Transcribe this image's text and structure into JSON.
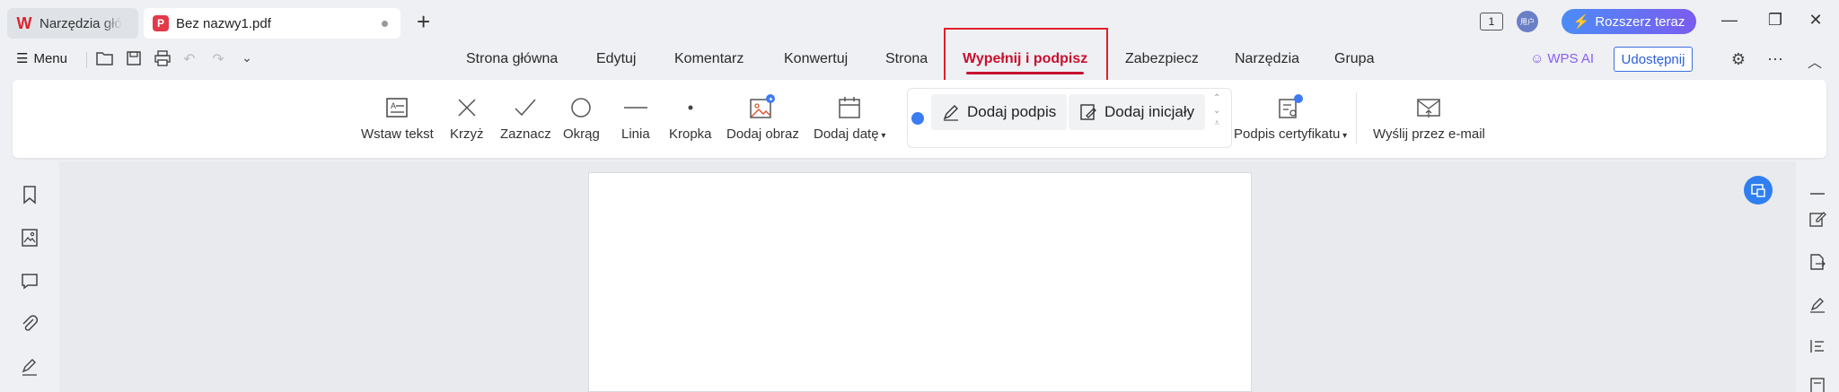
{
  "tabs": [
    {
      "label": "Narzędzia głó",
      "logo": "W",
      "active": false
    },
    {
      "label": "Bez nazwy1.pdf",
      "logo": "P",
      "active": true
    }
  ],
  "newtab_glyph": "+",
  "header": {
    "page_count_badge": "1",
    "avatar_text": "用户",
    "upgrade_label": "Rozszerz teraz",
    "window_controls": {
      "minimize": "—",
      "restore": "❐",
      "close": "✕"
    }
  },
  "menubar": {
    "menu_label": "Menu",
    "nav_tabs": [
      "Strona główna",
      "Edytuj",
      "Komentarz",
      "Konwertuj",
      "Strona",
      "Wypełnij i podpisz",
      "Zabezpiecz",
      "Narzędzia",
      "Grupa"
    ],
    "active_tab": "Wypełnij i podpisz",
    "wps_ai_label": "WPS AI",
    "share_label": "Udostępnij"
  },
  "ribbon": {
    "tools": [
      {
        "label": "Wstaw tekst",
        "icon": "insert-text-icon"
      },
      {
        "label": "Krzyż",
        "icon": "cross-icon"
      },
      {
        "label": "Zaznacz",
        "icon": "check-icon"
      },
      {
        "label": "Okrąg",
        "icon": "circle-icon"
      },
      {
        "label": "Linia",
        "icon": "line-icon"
      },
      {
        "label": "Kropka",
        "icon": "dot-icon"
      },
      {
        "label": "Dodaj obraz",
        "icon": "image-icon"
      },
      {
        "label": "Dodaj datę",
        "icon": "calendar-icon"
      }
    ],
    "add_signature_label": "Dodaj podpis",
    "add_initials_label": "Dodaj inicjały",
    "cert_signature_label": "Podpis certyfikatu",
    "send_email_label": "Wyślij przez e-mail"
  },
  "colors": {
    "accent_red": "#c8102e",
    "highlight_box": "#e0202a",
    "share_blue": "#2a5fd8",
    "ai_purple": "#8a5cf5",
    "upgrade_gradient_start": "#4b8cf7",
    "upgrade_gradient_end": "#7b5cf0"
  }
}
